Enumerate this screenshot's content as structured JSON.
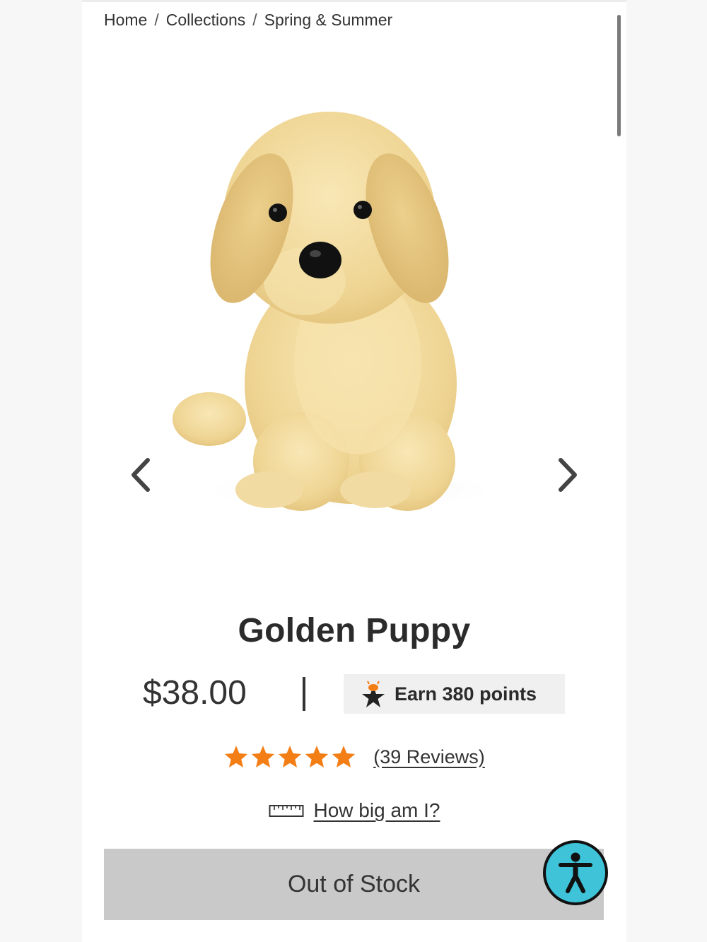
{
  "breadcrumb": {
    "items": [
      "Home",
      "Collections",
      "Spring & Summer"
    ],
    "separator": "/"
  },
  "product": {
    "title": "Golden Puppy",
    "price": "$38.00",
    "price_divider": "|",
    "points_label": "Earn 380 points",
    "rating": {
      "stars": 5,
      "max_stars": 5,
      "reviews_label": "(39 Reviews)"
    },
    "size_guide_label": "How big am I?",
    "stock_button_label": "Out of Stock"
  },
  "colors": {
    "star": "#f47e16",
    "button_bg": "#c9c9c9",
    "accessibility_bg": "#3ec3d8",
    "points_bg": "#f0f0f0",
    "plush_fur": "#f0d79a"
  },
  "icons": {
    "prev": "chevron-left-icon",
    "next": "chevron-right-icon",
    "points": "rewards-star-badge-icon",
    "size": "ruler-icon",
    "accessibility": "accessibility-person-icon"
  }
}
